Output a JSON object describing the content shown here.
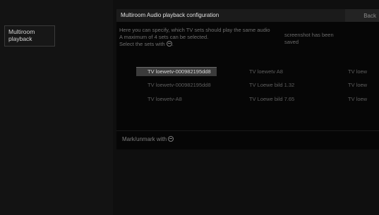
{
  "sidebar": {
    "items": [
      {
        "label_line1": "Multiroom",
        "label_line2": "playback"
      }
    ]
  },
  "panel": {
    "title": "Multiroom Audio playback configuration",
    "back_label": "Back",
    "info_lines": [
      "Here you can specify, which TV sets should play the same audio",
      "A maximum of 4 sets can be selected.",
      "Select the sets with"
    ],
    "ok_icon": "ok-button-icon",
    "toast_line1": "screenshot has been",
    "toast_line2": "saved",
    "footer_hint": "Mark/unmark with"
  },
  "tv_grid": {
    "rows": [
      [
        "TV loewetv-000982195dd8",
        "TV loewetv A8",
        "TV loew"
      ],
      [
        "TV loewetv-000982195dd8",
        "TV Loewe bild 1.32",
        "TV loew"
      ],
      [
        "TV loewetv-A8",
        "TV Loewe bild 7.65",
        "TV loew"
      ]
    ]
  },
  "colors": {
    "background": "#0f0f0f",
    "panel": "#060606",
    "focus": "#3b3b3b"
  }
}
